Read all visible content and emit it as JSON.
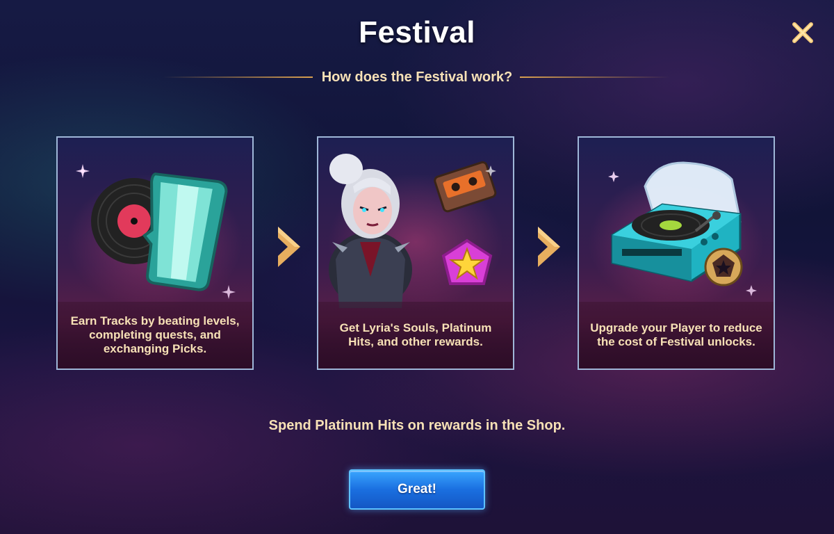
{
  "dialog": {
    "title": "Festival",
    "subtitle": "How does the Festival work?",
    "close_icon": "close-icon",
    "accent_color": "#f7e1b6"
  },
  "steps": [
    {
      "icon": "vinyl-record-with-track-card-icon",
      "text": "Earn Tracks by beating levels, completing quests, and exchanging Picks."
    },
    {
      "icon": "lyria-hero-with-cassette-and-platinum-hit-icon",
      "text": "Get Lyria's Souls, Platinum Hits, and other rewards."
    },
    {
      "icon": "turntable-player-icon",
      "text": "Upgrade your Player to reduce the cost of Festival unlocks."
    }
  ],
  "footer": {
    "text": "Spend Platinum Hits on rewards in the Shop."
  },
  "buttons": {
    "confirm_label": "Great!"
  }
}
